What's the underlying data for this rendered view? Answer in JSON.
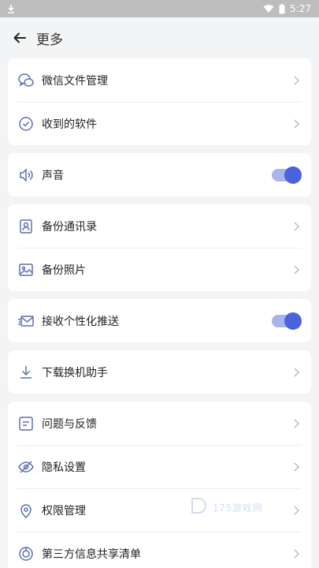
{
  "status_bar": {
    "time": "5:27"
  },
  "header": {
    "title": "更多"
  },
  "groups": [
    {
      "items": [
        {
          "label": "微信文件管理",
          "icon": "wechat-icon"
        },
        {
          "label": "收到的软件",
          "icon": "check-circle-icon"
        }
      ]
    },
    {
      "items": [
        {
          "label": "声音",
          "icon": "speaker-icon",
          "toggle": true
        }
      ]
    },
    {
      "items": [
        {
          "label": "备份通讯录",
          "icon": "contact-icon"
        },
        {
          "label": "备份照片",
          "icon": "photo-icon"
        }
      ]
    },
    {
      "items": [
        {
          "label": "接收个性化推送",
          "icon": "mail-icon",
          "toggle": true
        }
      ]
    },
    {
      "items": [
        {
          "label": "下载换机助手",
          "icon": "download-icon"
        }
      ]
    },
    {
      "items": [
        {
          "label": "问题与反馈",
          "icon": "feedback-icon"
        },
        {
          "label": "隐私设置",
          "icon": "privacy-eye-icon"
        },
        {
          "label": "权限管理",
          "icon": "location-shield-icon"
        },
        {
          "label": "第三方信息共享清单",
          "icon": "share-icon"
        }
      ]
    }
  ],
  "colors": {
    "accent": "#4a63dd",
    "toggle_track": "#a8b4ea",
    "icon": "#5d6fb0"
  },
  "watermark": {
    "text": "175游戏网"
  }
}
